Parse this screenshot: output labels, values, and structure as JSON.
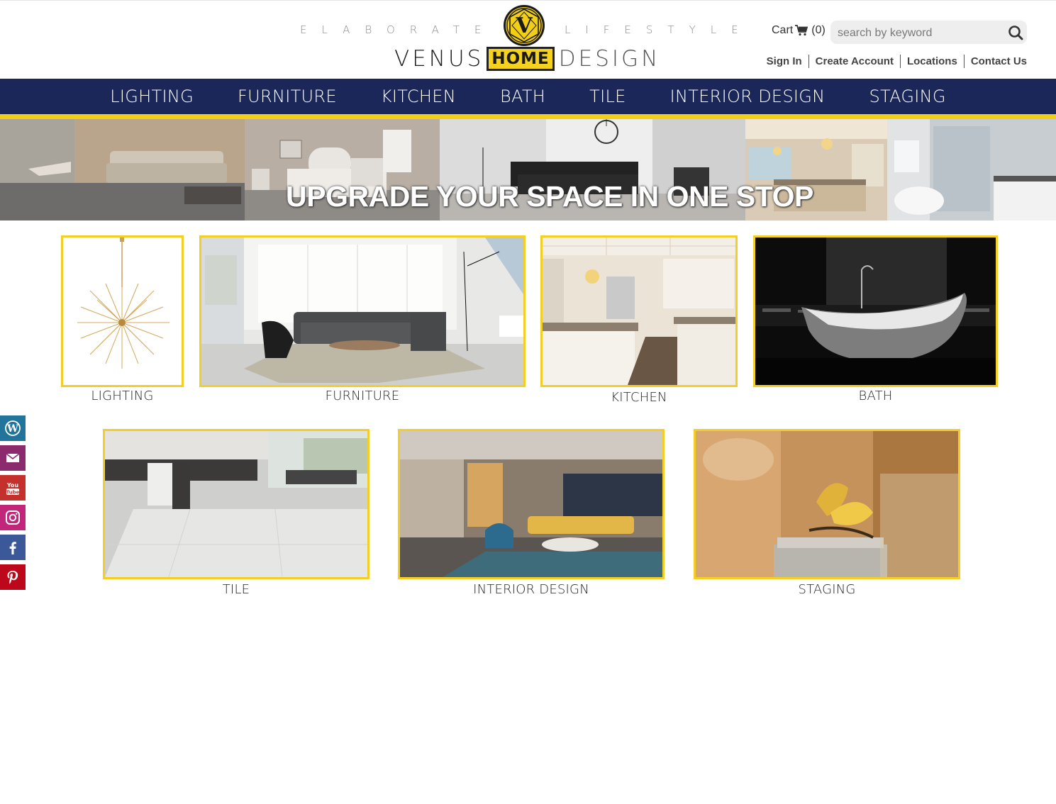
{
  "brand": {
    "tagline_left": "ELABORATE",
    "tagline_right": "LIFESTYLE",
    "word_left": "VENUS",
    "word_box": "HOME",
    "word_right": "DESIGN",
    "emblem_letter": "V",
    "accent_color": "#f2cf16",
    "nav_color": "#1b2659"
  },
  "header": {
    "cart_label": "Cart",
    "cart_icon": "shopping-cart-icon",
    "cart_count": "(0)",
    "search_placeholder": "search by keyword",
    "search_icon": "search-icon",
    "account_links": [
      "Sign In",
      "Create Account",
      "Locations",
      "Contact Us"
    ]
  },
  "nav": {
    "items": [
      "LIGHTING",
      "FURNITURE",
      "KITCHEN",
      "BATH",
      "TILE",
      "INTERIOR DESIGN",
      "STAGING"
    ]
  },
  "banner": {
    "headline": "UPGRADE YOUR SPACE IN ONE STOP"
  },
  "categories": [
    {
      "label": "LIGHTING",
      "image": "gold-sputnik-chandelier"
    },
    {
      "label": "FURNITURE",
      "image": "living-room-sectional-sofa"
    },
    {
      "label": "KITCHEN",
      "image": "white-kitchen-with-island"
    },
    {
      "label": "BATH",
      "image": "freestanding-bathtub"
    },
    {
      "label": "TILE",
      "image": "marble-floor-kitchen"
    },
    {
      "label": "INTERIOR DESIGN",
      "image": "modern-living-room-interior"
    },
    {
      "label": "STAGING",
      "image": "gold-butterfly-decor"
    }
  ],
  "social": [
    {
      "name": "wordpress-icon",
      "color": "#21759b"
    },
    {
      "name": "email-icon",
      "color": "#8b2a6d"
    },
    {
      "name": "youtube-icon",
      "color": "#c4302b"
    },
    {
      "name": "instagram-icon",
      "color": "#c1267a"
    },
    {
      "name": "facebook-icon",
      "color": "#3b5998"
    },
    {
      "name": "pinterest-icon",
      "color": "#bd081c"
    }
  ]
}
